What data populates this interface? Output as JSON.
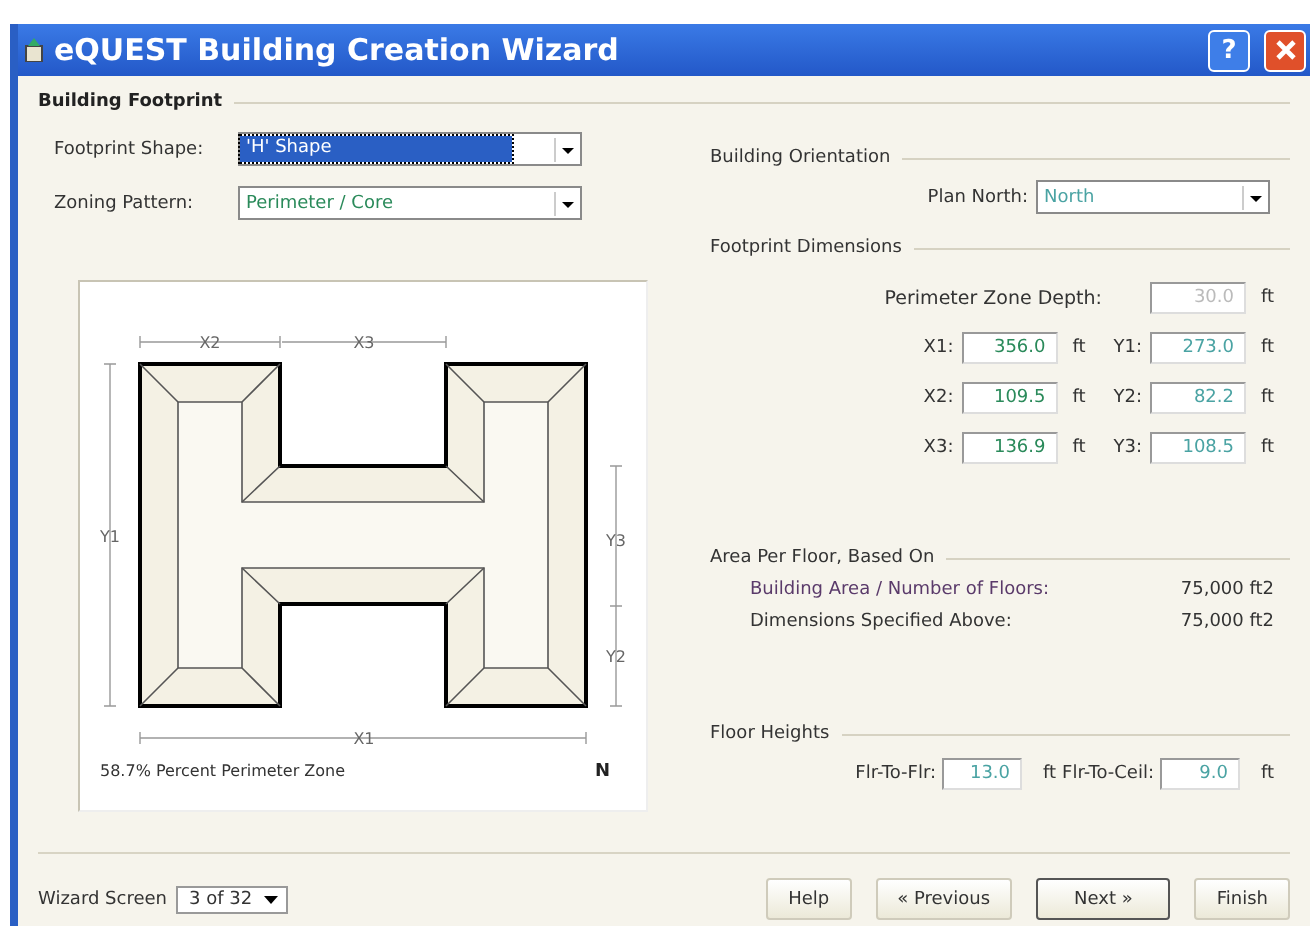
{
  "window": {
    "title": "eQUEST Building Creation Wizard",
    "help_button": "?"
  },
  "group_title": "Building Footprint",
  "left_fields": [
    {
      "label": "Footprint Shape:",
      "value": "'H' Shape",
      "selected": true
    },
    {
      "label": "Zoning Pattern:",
      "value": "Perimeter / Core",
      "selected": false
    }
  ],
  "drawing": {
    "x2": "X2",
    "x3": "X3",
    "y1": "Y1",
    "y3": "Y3",
    "y2": "Y2",
    "x1": "X1",
    "caption": "58.7% Percent Perimeter Zone",
    "north": "N"
  },
  "orientation": {
    "heading": "Building Orientation",
    "label": "Plan North:",
    "value": "North"
  },
  "dimensions": {
    "heading": "Footprint Dimensions",
    "depth": {
      "label": "Perimeter Zone Depth:",
      "value": "30.0",
      "unit": "ft",
      "disabled": true
    },
    "rows": [
      [
        {
          "label": "X1:",
          "value": "356.0",
          "unit": "ft",
          "disabled": false
        },
        {
          "label": "Y1:",
          "value": "273.0",
          "unit": "ft",
          "disabled": false
        }
      ],
      [
        {
          "label": "X2:",
          "value": "109.5",
          "unit": "ft",
          "disabled": false
        },
        {
          "label": "Y2:",
          "value": "82.2",
          "unit": "ft",
          "disabled": false
        }
      ],
      [
        {
          "label": "X3:",
          "value": "136.9",
          "unit": "ft",
          "disabled": false
        },
        {
          "label": "Y3:",
          "value": "108.5",
          "unit": "ft",
          "disabled": false
        }
      ]
    ]
  },
  "area": {
    "heading": "Area Per Floor, Based On",
    "rows": [
      {
        "label": "Building Area / Number of Floors:",
        "value": "75,000 ft2"
      },
      {
        "label": "Dimensions Specified Above:",
        "value": "75,000 ft2"
      }
    ]
  },
  "heights": {
    "heading": "Floor Heights",
    "fields": [
      {
        "label": "Flr-To-Flr:",
        "value": "13.0",
        "unit": "ft"
      },
      {
        "label": "Flr-To-Ceil:",
        "value": "9.0",
        "unit": "ft"
      }
    ]
  },
  "footer": {
    "label": "Wizard Screen",
    "screen": "3 of 32",
    "buttons": [
      {
        "label": "Help",
        "selected": false
      },
      {
        "label": "« Previous",
        "selected": false
      },
      {
        "label": "Next »",
        "selected": true
      },
      {
        "label": "Finish",
        "selected": false
      }
    ]
  }
}
